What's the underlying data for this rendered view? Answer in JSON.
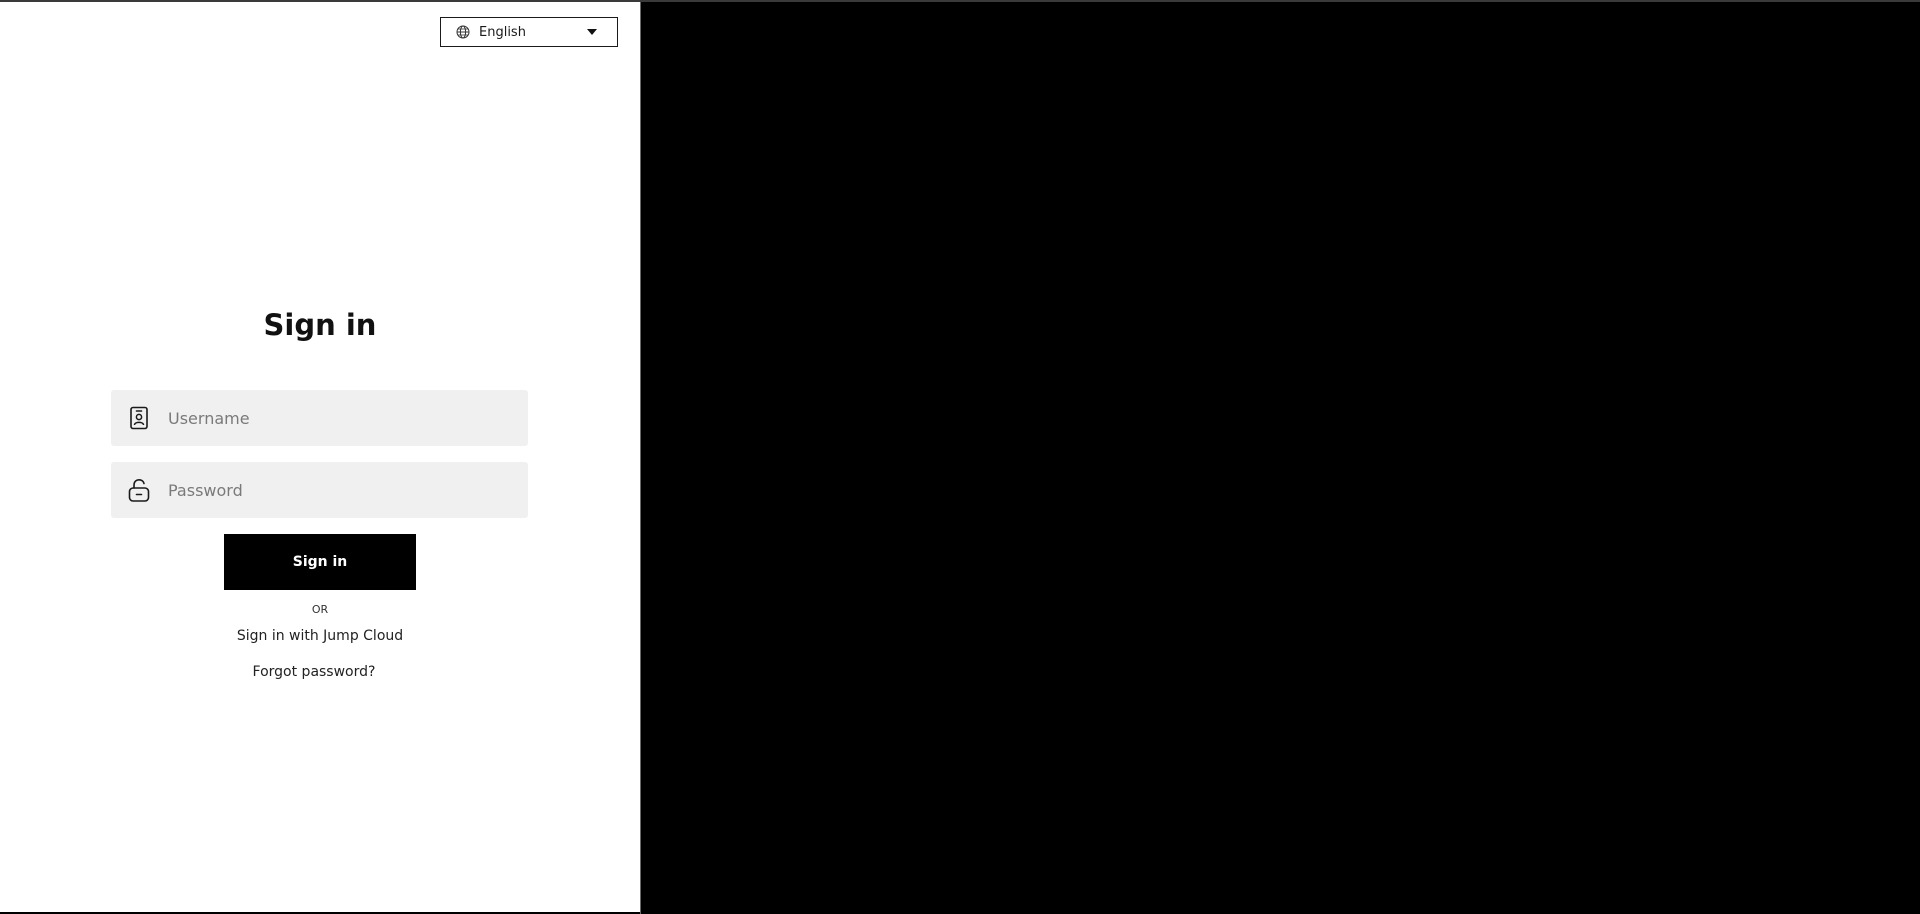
{
  "language_selector": {
    "selected": "English",
    "icon": "globe-icon"
  },
  "signin": {
    "title": "Sign in",
    "username": {
      "placeholder": "Username",
      "value": "",
      "icon": "badge-icon"
    },
    "password": {
      "placeholder": "Password",
      "value": "",
      "icon": "unlock-icon"
    },
    "button_label": "Sign in",
    "or_text": "OR",
    "sso_link": "Sign in with Jump Cloud",
    "forgot_link": "Forgot password?"
  },
  "colors": {
    "panel_background": "#ffffff",
    "right_background": "#000000",
    "field_background": "#f0f0f0",
    "button_background": "#000000",
    "button_text": "#ffffff"
  }
}
